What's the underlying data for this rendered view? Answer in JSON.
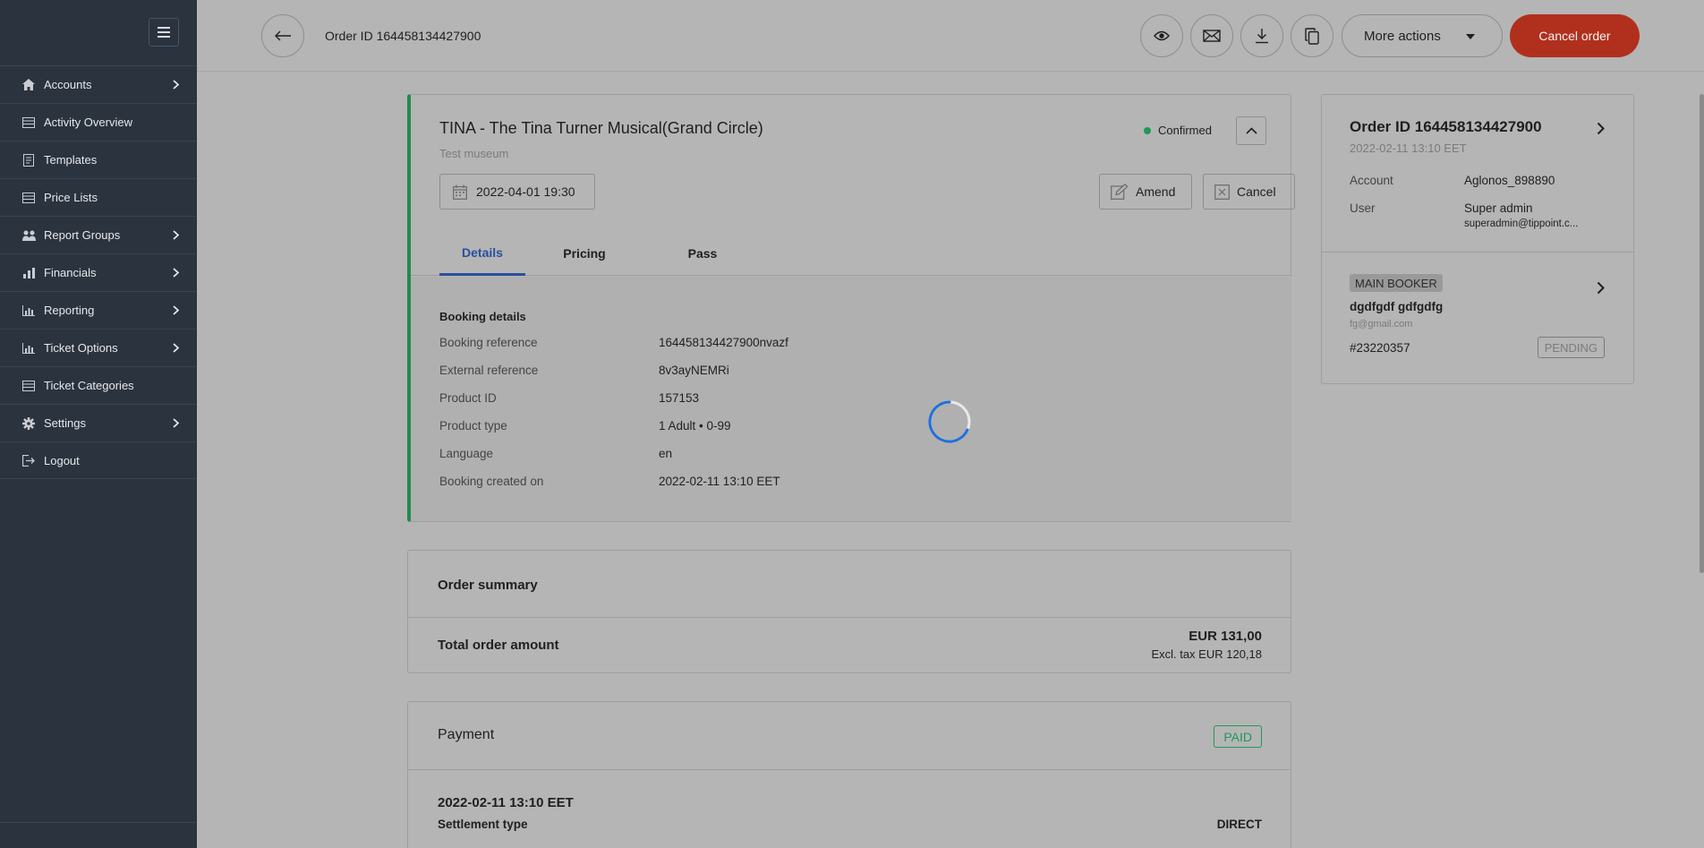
{
  "sidebar": {
    "items": [
      {
        "label": "Accounts",
        "icon": "home-icon",
        "has_children": true
      },
      {
        "label": "Activity Overview",
        "icon": "list-icon",
        "has_children": false
      },
      {
        "label": "Templates",
        "icon": "document-icon",
        "has_children": false
      },
      {
        "label": "Price Lists",
        "icon": "list-icon",
        "has_children": false
      },
      {
        "label": "Report Groups",
        "icon": "users-icon",
        "has_children": true
      },
      {
        "label": "Financials",
        "icon": "bar-chart-icon",
        "has_children": true
      },
      {
        "label": "Reporting",
        "icon": "area-chart-icon",
        "has_children": true
      },
      {
        "label": "Ticket Options",
        "icon": "area-chart-icon",
        "has_children": true
      },
      {
        "label": "Ticket Categories",
        "icon": "list-icon",
        "has_children": false
      },
      {
        "label": "Settings",
        "icon": "gear-icon",
        "has_children": true
      },
      {
        "label": "Logout",
        "icon": "logout-icon",
        "has_children": false
      }
    ]
  },
  "topbar": {
    "title": "Order ID 164458134427900",
    "more_actions_label": "More actions",
    "cancel_order_label": "Cancel order",
    "icon_buttons": [
      "eye-icon",
      "envelope-icon",
      "download-icon",
      "copy-icon"
    ]
  },
  "booking": {
    "title": "TINA - The Tina Turner Musical(Grand Circle)",
    "subtitle": "Test museum",
    "status": "Confirmed",
    "date": "2022-04-01 19:30",
    "amend_label": "Amend",
    "cancel_label": "Cancel",
    "tabs": [
      "Details",
      "Pricing",
      "Pass"
    ],
    "active_tab": "Details",
    "details_title": "Booking details",
    "details": [
      {
        "label": "Booking reference",
        "value": "164458134427900nvazf"
      },
      {
        "label": "External reference",
        "value": "8v3ayNEMRi"
      },
      {
        "label": "Product ID",
        "value": "157153"
      },
      {
        "label": "Product type",
        "value": "1 Adult • 0-99"
      },
      {
        "label": "Language",
        "value": "en"
      },
      {
        "label": "Booking created on",
        "value": "2022-02-11 13:10 EET"
      }
    ]
  },
  "order_summary": {
    "title": "Order summary",
    "total_label": "Total order amount",
    "total_amount": "EUR 131,00",
    "excl_tax": "Excl. tax EUR 120,18"
  },
  "payment": {
    "title": "Payment",
    "status_badge": "PAID",
    "date": "2022-02-11 13:10 EET",
    "settlement_label": "Settlement type",
    "settlement_value": "DIRECT"
  },
  "order_panel": {
    "title": "Order ID 164458134427900",
    "date": "2022-02-11 13:10 EET",
    "account_label": "Account",
    "account_value": "Aglonos_898890",
    "user_label": "User",
    "user_value": "Super admin",
    "user_email": "superadmin@tippoint.c...",
    "main_booker_badge": "MAIN BOOKER",
    "booker_name": "dgdfgdf gdfgdfg",
    "booker_email": "fg@gmail.com",
    "booker_id": "#23220357",
    "booker_status": "PENDING"
  },
  "colors": {
    "sidebar_bg": "#2b333f",
    "accent_red": "#b1301d",
    "confirmed_green": "#1e9a55",
    "active_tab_blue": "#2a4f9e",
    "spinner_blue": "#1f6fd9"
  }
}
